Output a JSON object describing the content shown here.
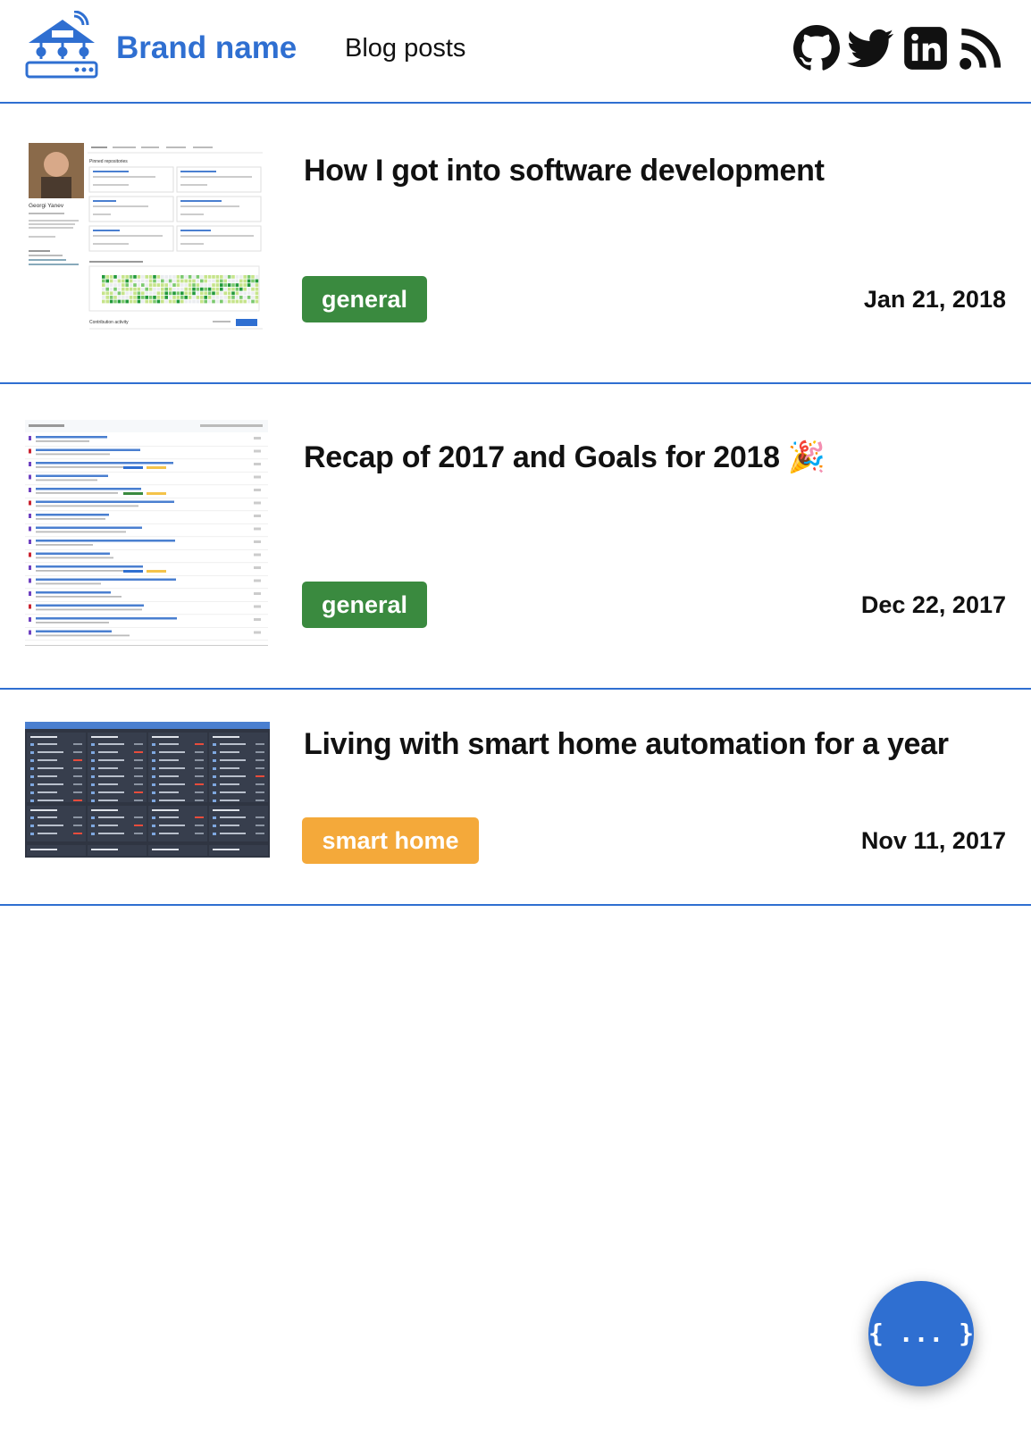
{
  "header": {
    "brand": "Brand name",
    "nav_link": "Blog posts",
    "social_icons": [
      "github-icon",
      "twitter-icon",
      "linkedin-icon",
      "rss-icon"
    ]
  },
  "posts": [
    {
      "title": "How I got into software development",
      "tag": "general",
      "tag_color": "#3a8a3f",
      "date": "Jan 21, 2018",
      "thumbnail": {
        "profile_name": "Georgi Yanev",
        "pinned_label": "Pinned repositories",
        "contributions_label": "Contribution activity"
      }
    },
    {
      "title": "Recap of 2017 and Goals for 2018",
      "title_emoji": "🎉",
      "tag": "general",
      "tag_color": "#3a8a3f",
      "date": "Dec 22, 2017"
    },
    {
      "title": "Living with smart home automation for a year",
      "tag": "smart home",
      "tag_color": "#f4a93a",
      "date": "Nov 11, 2017"
    }
  ],
  "fab": {
    "label": "{ ... }"
  },
  "colors": {
    "accent": "#2f6fd1",
    "general_tag": "#3a8a3f",
    "smart_home_tag": "#f4a93a"
  }
}
